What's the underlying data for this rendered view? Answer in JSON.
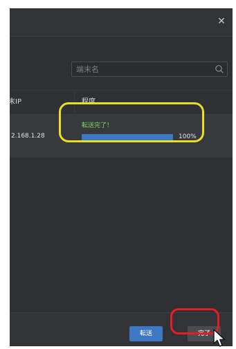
{
  "dialog": {
    "close_icon": "close-icon"
  },
  "search": {
    "placeholder": "端末名",
    "icon": "search-icon"
  },
  "table": {
    "headers": {
      "ip": "末IP",
      "progress": "程度"
    },
    "rows": [
      {
        "ip": "2.168.1.28",
        "status": "転送完了！",
        "progress": 1.0,
        "percent_text": "100%"
      }
    ]
  },
  "footer": {
    "transfer_label": "転送",
    "done_label": "完了"
  },
  "colors": {
    "accent_blue": "#3e78c3",
    "success_green": "#7fd35c",
    "highlight_yellow": "#e7e023",
    "highlight_red": "#e31e24"
  }
}
